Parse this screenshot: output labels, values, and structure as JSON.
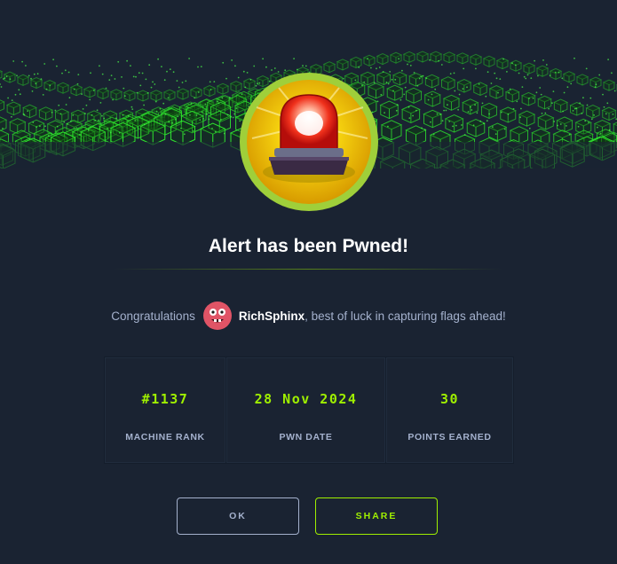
{
  "modal": {
    "title": "Alert has been Pwned!",
    "congrats_prefix": "Congratulations",
    "username": "RichSphinx",
    "congrats_suffix": ", best of luck in capturing flags ahead!"
  },
  "stats": [
    {
      "value": "#1137",
      "label": "MACHINE RANK"
    },
    {
      "value": "28 Nov 2024",
      "label": "PWN DATE"
    },
    {
      "value": "30",
      "label": "POINTS EARNED"
    }
  ],
  "buttons": {
    "ok_label": "OK",
    "share_label": "SHARE"
  },
  "colors": {
    "background": "#1a2332",
    "accent": "#9fef00",
    "muted_text": "#a4b1cd",
    "badge_ring": "#9fcf3a"
  },
  "icons": {
    "banner": "green-cube-wave-banner",
    "badge": "alert-siren-icon",
    "avatar": "pink-monster-avatar-icon"
  }
}
